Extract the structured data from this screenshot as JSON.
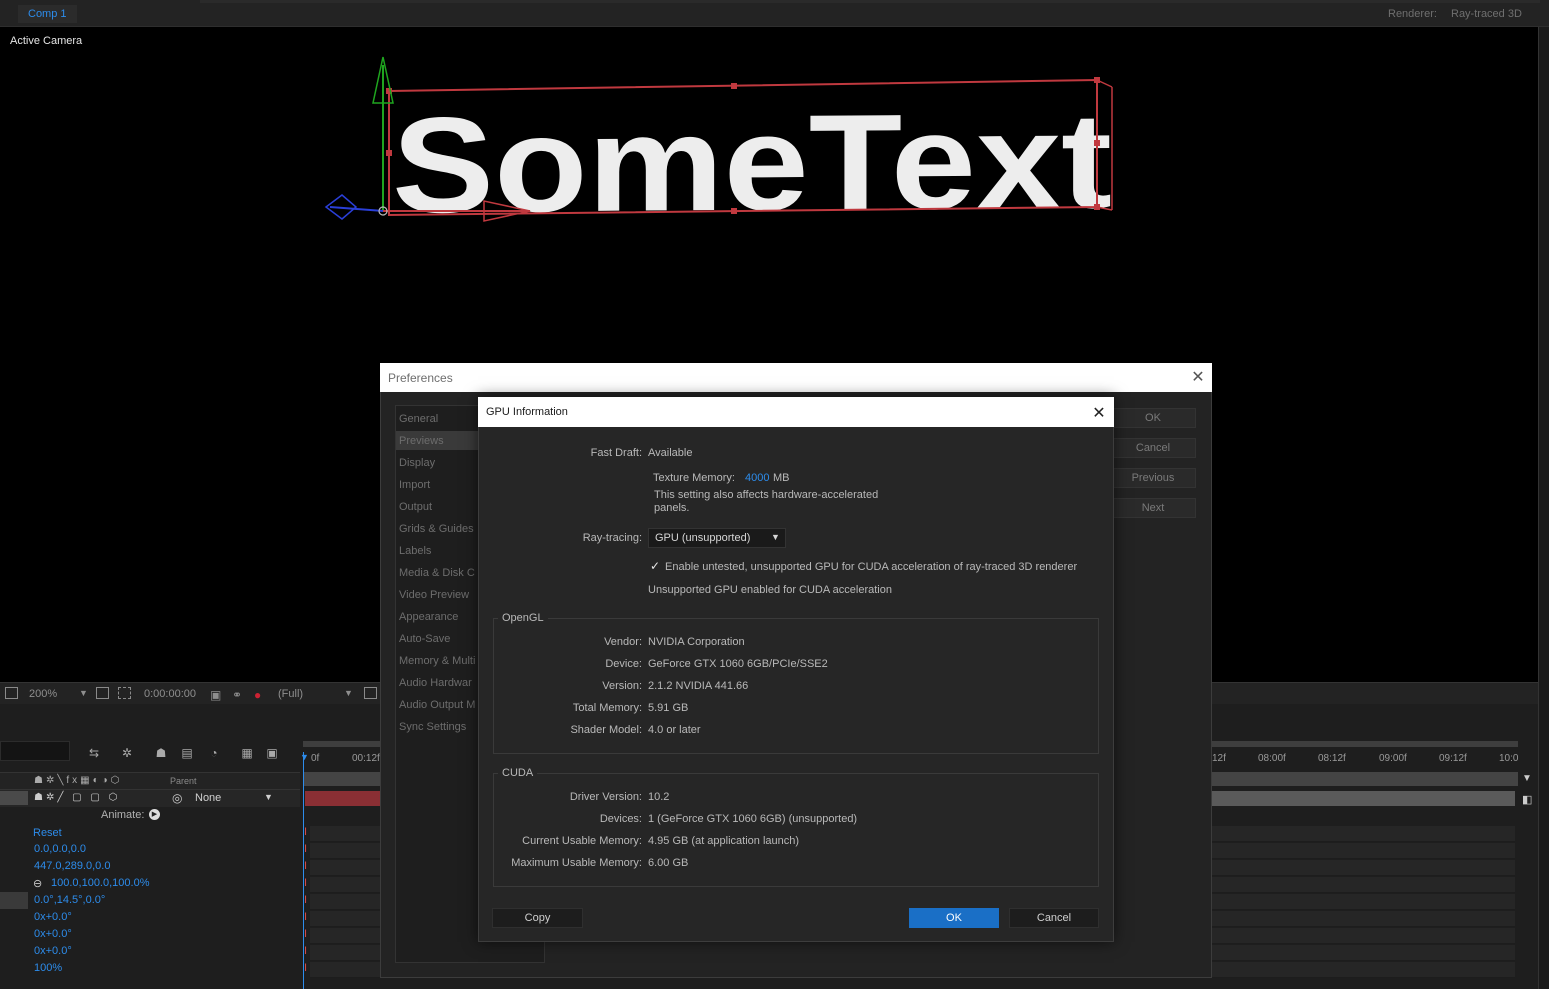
{
  "top": {
    "comp_tab": "Comp 1",
    "renderer_label": "Renderer:",
    "renderer_value": "Ray-traced 3D"
  },
  "viewer": {
    "camera_label": "Active Camera",
    "scene_text": "SomeText"
  },
  "viewer_footer": {
    "zoom": "200%",
    "timecode": "0:00:00:00",
    "resolution": "(Full)"
  },
  "timeline": {
    "parent_header": "Parent",
    "parent_value": "None",
    "animate_label": "Animate:",
    "properties": [
      "Reset",
      "0.0,0.0,0.0",
      "447.0,289.0,0.0",
      "100.0,100.0,100.0%",
      "0.0°,14.5°,0.0°",
      "0x+0.0°",
      "0x+0.0°",
      "0x+0.0°",
      "100%"
    ],
    "ruler_labels": [
      "0f",
      "00:12f",
      "12f",
      "08:00f",
      "08:12f",
      "09:00f",
      "09:12f",
      "10:0"
    ]
  },
  "preferences": {
    "title": "Preferences",
    "categories": [
      "General",
      "Previews",
      "Display",
      "Import",
      "Output",
      "Grids & Guides",
      "Labels",
      "Media & Disk C",
      "Video Preview",
      "Appearance",
      "Auto-Save",
      "Memory & Multi",
      "Audio Hardwar",
      "Audio Output M",
      "Sync Settings"
    ],
    "selected_category": "Previews",
    "buttons": [
      "OK",
      "Cancel",
      "Previous",
      "Next"
    ]
  },
  "gpu_info": {
    "title": "GPU Information",
    "fast_draft_label": "Fast Draft:",
    "fast_draft_value": "Available",
    "texture_memory_label": "Texture Memory:",
    "texture_memory_value": "4000",
    "texture_memory_unit": "MB",
    "texture_note": "This setting also affects hardware-accelerated panels.",
    "ray_tracing_label": "Ray-tracing:",
    "ray_tracing_value": "GPU (unsupported)",
    "checkbox_label": "Enable untested, unsupported GPU for CUDA acceleration of ray-traced 3D renderer",
    "checkbox_checked": true,
    "unsupported_note": "Unsupported GPU enabled for CUDA acceleration",
    "opengl": {
      "title": "OpenGL",
      "rows": [
        {
          "label": "Vendor:",
          "value": "NVIDIA Corporation"
        },
        {
          "label": "Device:",
          "value": "GeForce GTX 1060 6GB/PCIe/SSE2"
        },
        {
          "label": "Version:",
          "value": "2.1.2 NVIDIA 441.66"
        },
        {
          "label": "Total Memory:",
          "value": "5.91 GB"
        },
        {
          "label": "Shader Model:",
          "value": "4.0 or later"
        }
      ]
    },
    "cuda": {
      "title": "CUDA",
      "rows": [
        {
          "label": "Driver Version:",
          "value": "10.2"
        },
        {
          "label": "Devices:",
          "value": "1 (GeForce GTX 1060 6GB) (unsupported)"
        },
        {
          "label": "Current Usable Memory:",
          "value": "4.95 GB (at application launch)"
        },
        {
          "label": "Maximum Usable Memory:",
          "value": "6.00 GB"
        }
      ]
    },
    "copy_button": "Copy",
    "ok_button": "OK",
    "cancel_button": "Cancel"
  },
  "colors": {
    "accent": "#2d8ceb",
    "keyframe": "#d24b4b",
    "bounding_box": "#c0393f"
  }
}
